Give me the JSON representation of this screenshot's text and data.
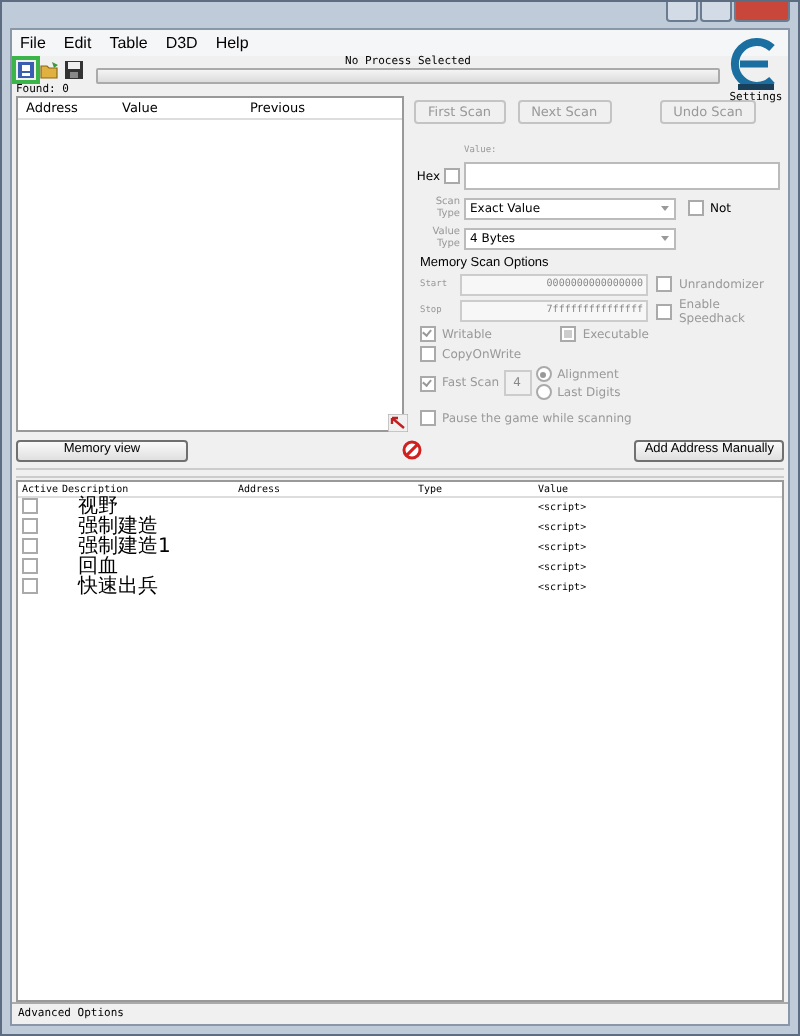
{
  "menu": [
    "File",
    "Edit",
    "Table",
    "D3D",
    "Help"
  ],
  "process": "No Process Selected",
  "progress": {
    "level": 0
  },
  "found": "Found: 0",
  "results_columns": [
    "Address",
    "Value",
    "Previous"
  ],
  "scan_buttons": [
    {
      "label": "First Scan",
      "disabled": true
    },
    {
      "label": "Next Scan",
      "disabled": true
    },
    {
      "label": "Undo Scan",
      "disabled": true
    }
  ],
  "settings_label": "Settings",
  "value_label": "Value:",
  "hex": {
    "label": "Hex",
    "checked": false
  },
  "scan_type": {
    "label": "Scan Type",
    "value": "Exact Value"
  },
  "not": {
    "label": "Not",
    "checked": false
  },
  "value_type": {
    "label": "Value Type",
    "value": "4 Bytes"
  },
  "memory_options": {
    "title": "Memory Scan Options",
    "disabled": true,
    "start": {
      "label": "Start",
      "value": "0000000000000000"
    },
    "stop": {
      "label": "Stop",
      "value": "7fffffffffffffff"
    },
    "flags": [
      {
        "label": "Writable",
        "checked": true
      },
      {
        "label": "Executable",
        "checked": false,
        "indeterminate": true
      }
    ],
    "copy_on_write": {
      "label": "CopyOnWrite",
      "checked": false
    },
    "fast_scan": {
      "label": "Fast Scan",
      "checked": true,
      "value": "4"
    },
    "alignment": [
      {
        "label": "Alignment",
        "selected": true
      },
      {
        "label": "Last Digits",
        "selected": false
      }
    ],
    "pause": {
      "label": "Pause the game while scanning",
      "checked": false
    }
  },
  "unrandomizer": {
    "label": "Unrandomizer",
    "checked": false
  },
  "speedhack": {
    "label": "Enable Speedhack",
    "checked": false
  },
  "memory_view_button": "Memory view",
  "add_address_button": "Add Address Manually",
  "table": {
    "columns": [
      "Active",
      "Description",
      "Address",
      "Type",
      "Value"
    ],
    "rows": [
      {
        "active": false,
        "description": "视野",
        "value": "<script>"
      },
      {
        "active": false,
        "description": "强制建造",
        "value": "<script>"
      },
      {
        "active": false,
        "description": "强制建造1",
        "value": "<script>"
      },
      {
        "active": false,
        "description": "回血",
        "value": "<script>"
      },
      {
        "active": false,
        "description": "快速出兵",
        "value": "<script>"
      }
    ]
  },
  "status_bar": "Advanced Options"
}
